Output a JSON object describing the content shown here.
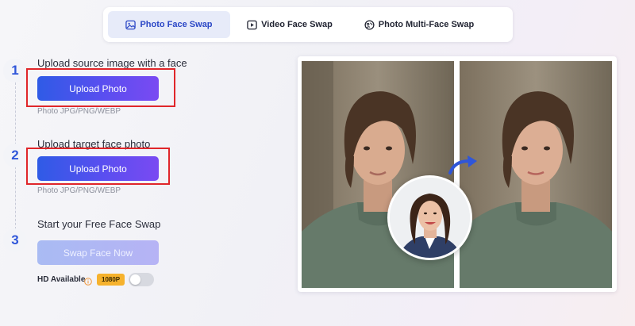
{
  "tabs": [
    {
      "label": "Photo Face Swap",
      "icon": "image-icon",
      "active": true
    },
    {
      "label": "Video Face Swap",
      "icon": "play-icon",
      "active": false
    },
    {
      "label": "Photo Multi-Face Swap",
      "icon": "multi-face-icon",
      "active": false
    }
  ],
  "steps": [
    {
      "number": "1",
      "title": "Upload source image with a face",
      "button": "Upload Photo",
      "hint": "Photo JPG/PNG/WEBP"
    },
    {
      "number": "2",
      "title": "Upload target face photo",
      "button": "Upload Photo",
      "hint": "Photo JPG/PNG/WEBP"
    },
    {
      "number": "3",
      "title": "Start your Free Face Swap",
      "button": "Swap Face Now"
    }
  ],
  "hd": {
    "label": "HD Available",
    "badge": "1080P",
    "enabled": false
  },
  "colors": {
    "accent": "#2f56d9",
    "button_gradient_start": "#2f5be6",
    "button_gradient_end": "#7a4af2",
    "highlight_box": "#e0262a",
    "badge": "#f6b22d"
  }
}
